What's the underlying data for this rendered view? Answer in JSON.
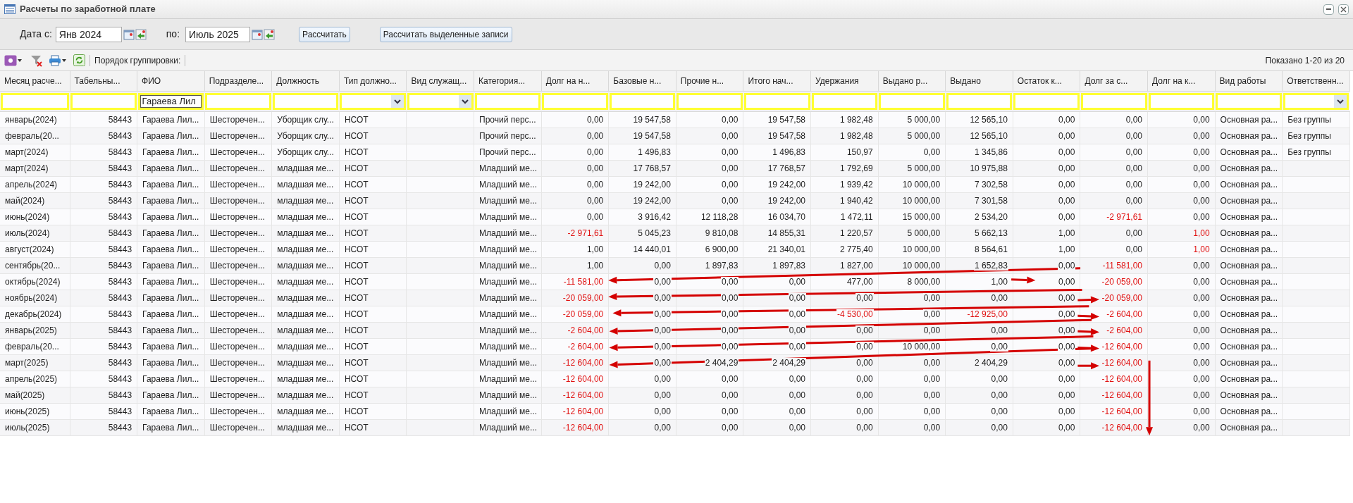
{
  "window": {
    "title": "Расчеты по заработной плате"
  },
  "period": {
    "from_label": "Дата с:",
    "from_value": "Янв 2024",
    "to_label": "по:",
    "to_value": "Июль 2025"
  },
  "buttons": [
    "Рассчитать",
    "Рассчитать выделенные записи"
  ],
  "grid_toolbar": {
    "grouping_label": "Порядок группировки:",
    "status": "Показано 1-20 из 20"
  },
  "columns": [
    {
      "title": "Месяц расче...",
      "kind": "text",
      "filter": {
        "kind": "text"
      }
    },
    {
      "title": "Табельны...",
      "kind": "number",
      "filter": {
        "kind": "text"
      }
    },
    {
      "title": "ФИО",
      "kind": "text",
      "filter": {
        "kind": "text",
        "value": "Гараева Лил"
      }
    },
    {
      "title": "Подразделе...",
      "kind": "text",
      "filter": {
        "kind": "text"
      }
    },
    {
      "title": "Должность",
      "kind": "text",
      "filter": {
        "kind": "text"
      }
    },
    {
      "title": "Тип должно...",
      "kind": "text",
      "filter": {
        "kind": "dropdown"
      }
    },
    {
      "title": "Вид служащ...",
      "kind": "text",
      "filter": {
        "kind": "dropdown"
      }
    },
    {
      "title": "Категория...",
      "kind": "text",
      "filter": {
        "kind": "text"
      }
    },
    {
      "title": "Долг на н...",
      "kind": "number",
      "filter": {
        "kind": "text"
      }
    },
    {
      "title": "Базовые н...",
      "kind": "number",
      "filter": {
        "kind": "text"
      }
    },
    {
      "title": "Прочие н...",
      "kind": "number",
      "filter": {
        "kind": "text"
      }
    },
    {
      "title": "Итого нач...",
      "kind": "number",
      "filter": {
        "kind": "text"
      }
    },
    {
      "title": "Удержания",
      "kind": "number",
      "filter": {
        "kind": "text"
      }
    },
    {
      "title": "Выдано р...",
      "kind": "number",
      "filter": {
        "kind": "text"
      }
    },
    {
      "title": "Выдано",
      "kind": "number",
      "filter": {
        "kind": "text"
      }
    },
    {
      "title": "Остаток к...",
      "kind": "number",
      "filter": {
        "kind": "text"
      }
    },
    {
      "title": "Долг за с...",
      "kind": "number",
      "filter": {
        "kind": "text"
      }
    },
    {
      "title": "Долг на к...",
      "kind": "number",
      "filter": {
        "kind": "text"
      }
    },
    {
      "title": "Вид работы",
      "kind": "text",
      "filter": {
        "kind": "text"
      }
    },
    {
      "title": "Ответственн...",
      "kind": "text",
      "filter": {
        "kind": "dropdown"
      }
    }
  ],
  "rows": [
    {
      "cells": [
        "январь(2024)",
        "58443",
        "Гараева Лил...",
        "Шесторечен...",
        "Уборщик слу...",
        "НСОТ",
        null,
        "Прочий перс...",
        "0,00",
        "19 547,58",
        "0,00",
        "19 547,58",
        "1 982,48",
        "5 000,00",
        "12 565,10",
        "0,00",
        "0,00",
        "0,00",
        "Основная ра...",
        "Без группы"
      ]
    },
    {
      "cells": [
        "февраль(20...",
        "58443",
        "Гараева Лил...",
        "Шесторечен...",
        "Уборщик слу...",
        "НСОТ",
        null,
        "Прочий перс...",
        "0,00",
        "19 547,58",
        "0,00",
        "19 547,58",
        "1 982,48",
        "5 000,00",
        "12 565,10",
        "0,00",
        "0,00",
        "0,00",
        "Основная ра...",
        "Без группы"
      ]
    },
    {
      "cells": [
        "март(2024)",
        "58443",
        "Гараева Лил...",
        "Шесторечен...",
        "Уборщик слу...",
        "НСОТ",
        null,
        "Прочий перс...",
        "0,00",
        "1 496,83",
        "0,00",
        "1 496,83",
        "150,97",
        "0,00",
        "1 345,86",
        "0,00",
        "0,00",
        "0,00",
        "Основная ра...",
        "Без группы"
      ]
    },
    {
      "cells": [
        "март(2024)",
        "58443",
        "Гараева Лил...",
        "Шесторечен...",
        "младшая ме...",
        "НСОТ",
        null,
        "Младший ме...",
        "0,00",
        "17 768,57",
        "0,00",
        "17 768,57",
        "1 792,69",
        "5 000,00",
        "10 975,88",
        "0,00",
        "0,00",
        "0,00",
        "Основная ра...",
        null
      ]
    },
    {
      "cells": [
        "апрель(2024)",
        "58443",
        "Гараева Лил...",
        "Шесторечен...",
        "младшая ме...",
        "НСОТ",
        null,
        "Младший ме...",
        "0,00",
        "19 242,00",
        "0,00",
        "19 242,00",
        "1 939,42",
        "10 000,00",
        "7 302,58",
        "0,00",
        "0,00",
        "0,00",
        "Основная ра...",
        null
      ]
    },
    {
      "cells": [
        "май(2024)",
        "58443",
        "Гараева Лил...",
        "Шесторечен...",
        "младшая ме...",
        "НСОТ",
        null,
        "Младший ме...",
        "0,00",
        "19 242,00",
        "0,00",
        "19 242,00",
        "1 940,42",
        "10 000,00",
        "7 301,58",
        "0,00",
        "0,00",
        "0,00",
        "Основная ра...",
        null
      ]
    },
    {
      "cells": [
        "июнь(2024)",
        "58443",
        "Гараева Лил...",
        "Шесторечен...",
        "младшая ме...",
        "НСОТ",
        null,
        "Младший ме...",
        "0,00",
        "3 916,42",
        "12 118,28",
        "16 034,70",
        "1 472,11",
        "15 000,00",
        "2 534,20",
        "0,00",
        {
          "text": "-2 971,61",
          "red": true
        },
        "0,00",
        "Основная ра...",
        null
      ]
    },
    {
      "cells": [
        "июль(2024)",
        "58443",
        "Гараева Лил...",
        "Шесторечен...",
        "младшая ме...",
        "НСОТ",
        null,
        "Младший ме...",
        {
          "text": "-2 971,61",
          "red": true
        },
        "5 045,23",
        "9 810,08",
        "14 855,31",
        "1 220,57",
        "5 000,00",
        "5 662,13",
        "1,00",
        "0,00",
        {
          "text": "1,00",
          "red": true
        },
        "Основная ра...",
        null
      ]
    },
    {
      "cells": [
        "август(2024)",
        "58443",
        "Гараева Лил...",
        "Шесторечен...",
        "младшая ме...",
        "НСОТ",
        null,
        "Младший ме...",
        "1,00",
        "14 440,01",
        "6 900,00",
        "21 340,01",
        "2 775,40",
        "10 000,00",
        "8 564,61",
        "1,00",
        "0,00",
        {
          "text": "1,00",
          "red": true
        },
        "Основная ра...",
        null
      ]
    },
    {
      "cells": [
        "сентябрь(20...",
        "58443",
        "Гараева Лил...",
        "Шесторечен...",
        "младшая ме...",
        "НСОТ",
        null,
        "Младший ме...",
        "1,00",
        "0,00",
        "1 897,83",
        "1 897,83",
        "1 827,00",
        "10 000,00",
        "1 652,83",
        "0,00",
        {
          "text": "-11 581,00",
          "red": true
        },
        "0,00",
        "Основная ра...",
        null
      ]
    },
    {
      "cells": [
        "октябрь(2024)",
        "58443",
        "Гараева Лил...",
        "Шесторечен...",
        "младшая ме...",
        "НСОТ",
        null,
        "Младший ме...",
        {
          "text": "-11 581,00",
          "red": true
        },
        "0,00",
        "0,00",
        "0,00",
        "477,00",
        "8 000,00",
        "1,00",
        "0,00",
        {
          "text": "-20 059,00",
          "red": true
        },
        "0,00",
        "Основная ра...",
        null
      ]
    },
    {
      "cells": [
        "ноябрь(2024)",
        "58443",
        "Гараева Лил...",
        "Шесторечен...",
        "младшая ме...",
        "НСОТ",
        null,
        "Младший ме...",
        {
          "text": "-20 059,00",
          "red": true
        },
        "0,00",
        "0,00",
        "0,00",
        "0,00",
        "0,00",
        "0,00",
        "0,00",
        {
          "text": "-20 059,00",
          "red": true
        },
        "0,00",
        "Основная ра...",
        null
      ]
    },
    {
      "cells": [
        "декабрь(2024)",
        "58443",
        "Гараева Лил...",
        "Шесторечен...",
        "младшая ме...",
        "НСОТ",
        null,
        "Младший ме...",
        {
          "text": "-20 059,00",
          "red": true
        },
        "0,00",
        "0,00",
        "0,00",
        {
          "text": "-4 530,00",
          "red": true
        },
        "0,00",
        {
          "text": "-12 925,00",
          "red": true
        },
        "0,00",
        {
          "text": "-2 604,00",
          "red": true
        },
        "0,00",
        "Основная ра...",
        null
      ]
    },
    {
      "cells": [
        "январь(2025)",
        "58443",
        "Гараева Лил...",
        "Шесторечен...",
        "младшая ме...",
        "НСОТ",
        null,
        "Младший ме...",
        {
          "text": "-2 604,00",
          "red": true
        },
        "0,00",
        "0,00",
        "0,00",
        "0,00",
        "0,00",
        "0,00",
        "0,00",
        {
          "text": "-2 604,00",
          "red": true
        },
        "0,00",
        "Основная ра...",
        null
      ]
    },
    {
      "cells": [
        "февраль(20...",
        "58443",
        "Гараева Лил...",
        "Шесторечен...",
        "младшая ме...",
        "НСОТ",
        null,
        "Младший ме...",
        {
          "text": "-2 604,00",
          "red": true
        },
        "0,00",
        "0,00",
        "0,00",
        "0,00",
        "10 000,00",
        "0,00",
        "0,00",
        {
          "text": "-12 604,00",
          "red": true
        },
        "0,00",
        "Основная ра...",
        null
      ]
    },
    {
      "cells": [
        "март(2025)",
        "58443",
        "Гараева Лил...",
        "Шесторечен...",
        "младшая ме...",
        "НСОТ",
        null,
        "Младший ме...",
        {
          "text": "-12 604,00",
          "red": true
        },
        "0,00",
        "2 404,29",
        "2 404,29",
        "0,00",
        "0,00",
        "2 404,29",
        "0,00",
        {
          "text": "-12 604,00",
          "red": true
        },
        "0,00",
        "Основная ра...",
        null
      ]
    },
    {
      "cells": [
        "апрель(2025)",
        "58443",
        "Гараева Лил...",
        "Шесторечен...",
        "младшая ме...",
        "НСОТ",
        null,
        "Младший ме...",
        {
          "text": "-12 604,00",
          "red": true
        },
        "0,00",
        "0,00",
        "0,00",
        "0,00",
        "0,00",
        "0,00",
        "0,00",
        {
          "text": "-12 604,00",
          "red": true
        },
        "0,00",
        "Основная ра...",
        null
      ]
    },
    {
      "cells": [
        "май(2025)",
        "58443",
        "Гараева Лил...",
        "Шесторечен...",
        "младшая ме...",
        "НСОТ",
        null,
        "Младший ме...",
        {
          "text": "-12 604,00",
          "red": true
        },
        "0,00",
        "0,00",
        "0,00",
        "0,00",
        "0,00",
        "0,00",
        "0,00",
        {
          "text": "-12 604,00",
          "red": true
        },
        "0,00",
        "Основная ра...",
        null
      ]
    },
    {
      "cells": [
        "июнь(2025)",
        "58443",
        "Гараева Лил...",
        "Шесторечен...",
        "младшая ме...",
        "НСОТ",
        null,
        "Младший ме...",
        {
          "text": "-12 604,00",
          "red": true
        },
        "0,00",
        "0,00",
        "0,00",
        "0,00",
        "0,00",
        "0,00",
        "0,00",
        {
          "text": "-12 604,00",
          "red": true
        },
        "0,00",
        "Основная ра...",
        null
      ]
    },
    {
      "cells": [
        "июль(2025)",
        "58443",
        "Гараева Лил...",
        "Шесторечен...",
        "младшая ме...",
        "НСОТ",
        null,
        "Младший ме...",
        {
          "text": "-12 604,00",
          "red": true
        },
        "0,00",
        "0,00",
        "0,00",
        "0,00",
        "0,00",
        "0,00",
        "0,00",
        {
          "text": "-12 604,00",
          "red": true
        },
        "0,00",
        "Основная ра...",
        null
      ]
    }
  ]
}
